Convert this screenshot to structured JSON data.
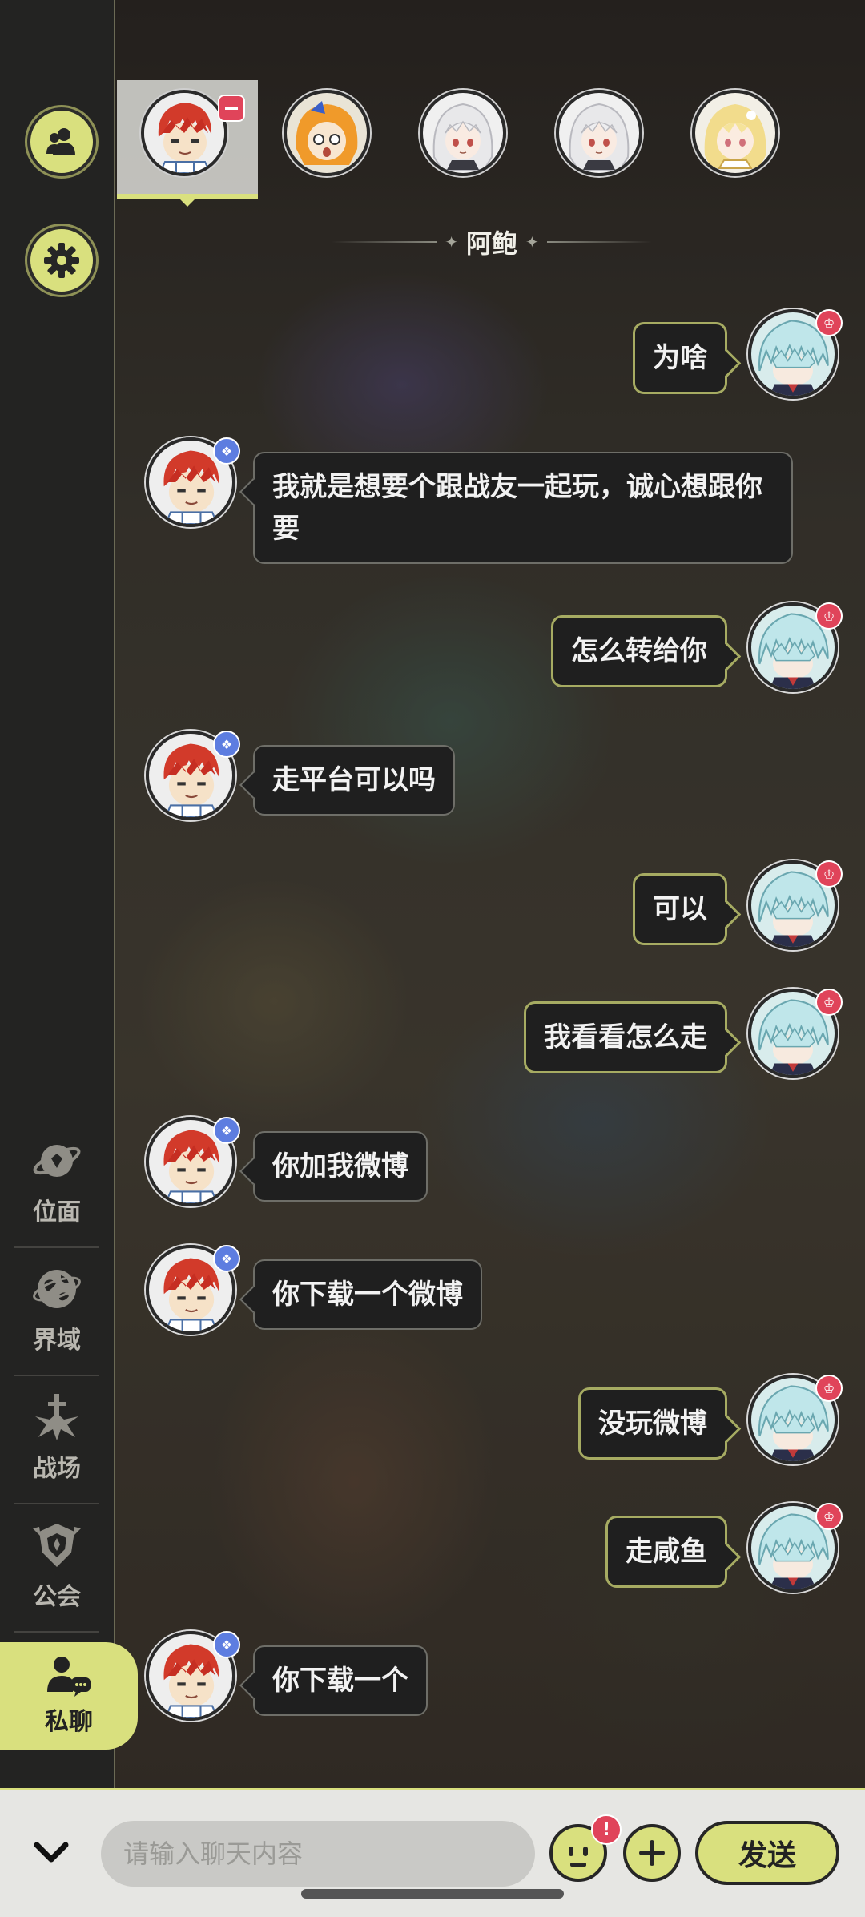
{
  "sidebar": {
    "top_buttons": [
      {
        "icon": "friends-icon"
      },
      {
        "icon": "gear-icon"
      }
    ],
    "nav": [
      {
        "label": "位面",
        "icon": "planet-icon"
      },
      {
        "label": "界域",
        "icon": "globe-icon"
      },
      {
        "label": "战场",
        "icon": "battlefield-icon"
      },
      {
        "label": "公会",
        "icon": "guild-crest-icon"
      },
      {
        "label": "私聊",
        "icon": "private-chat-icon",
        "active": true
      }
    ]
  },
  "contacts": [
    {
      "name": "red-hair-boy",
      "selected": true,
      "has_remove": true
    },
    {
      "name": "orange-hair-girl"
    },
    {
      "name": "white-hair-girl-1"
    },
    {
      "name": "white-hair-girl-2"
    },
    {
      "name": "blonde-girl"
    }
  ],
  "chat": {
    "title": "阿鲍",
    "messages": [
      {
        "side": "right",
        "text": "为啥"
      },
      {
        "side": "left",
        "text": "我就是想要个跟战友一起玩，诚心想跟你要"
      },
      {
        "side": "right",
        "text": "怎么转给你"
      },
      {
        "side": "left",
        "text": "走平台可以吗"
      },
      {
        "side": "right",
        "text": "可以"
      },
      {
        "side": "right",
        "text": "我看看怎么走"
      },
      {
        "side": "left",
        "text": "你加我微博"
      },
      {
        "side": "left",
        "text": "你下载一个微博"
      },
      {
        "side": "right",
        "text": "没玩微博"
      },
      {
        "side": "right",
        "text": "走咸鱼"
      },
      {
        "side": "left",
        "text": "你下载一个"
      }
    ]
  },
  "input": {
    "placeholder": "请输入聊天内容",
    "value": "",
    "emoji_alert": "!",
    "send_label": "发送"
  },
  "colors": {
    "accent": "#d9e07e",
    "bubble_bg": "#1f1f1f",
    "sidebar_bg": "#232322",
    "badge_red": "#e0445a",
    "badge_blue": "#5d7de0"
  }
}
